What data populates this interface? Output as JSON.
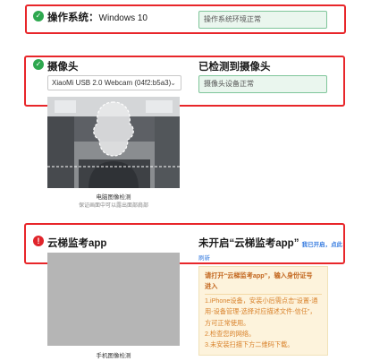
{
  "os": {
    "title": "操作系统",
    "value": "Windows 10",
    "status": "操作系统环境正常"
  },
  "camera": {
    "title": "摄像头",
    "device_selected": "XiaoMi USB 2.0 Webcam (04f2:b5a3)",
    "heading": "已检测到摄像头",
    "status": "摄像头设备正常",
    "caption": "电脑图像检测",
    "subcaption": "保证画面中可以露出面部肩部"
  },
  "app": {
    "title": "云梯监考app",
    "heading": "未开启“云梯监考app”",
    "link_text": "我已开启，点此",
    "link_text_2": "刷新",
    "caption": "手机图像检测",
    "notice": {
      "line1": "请打开“云梯监考app”，输入身份证号",
      "line2": "进入",
      "line3": "1.iPhone设备，安装小后需点击“设置-通",
      "line4": "用-设备管理-选择对应描述文件-信任”，",
      "line5": "方可正常使用。",
      "line6": "2.检查您的网络。",
      "line7": "3.未安装扫描下方二维码下载。"
    }
  },
  "colors": {
    "highlight": "#e8262a",
    "success": "#2ea84f",
    "error": "#e0242a",
    "link": "#3a7ee0",
    "notice_text": "#d9822b"
  }
}
